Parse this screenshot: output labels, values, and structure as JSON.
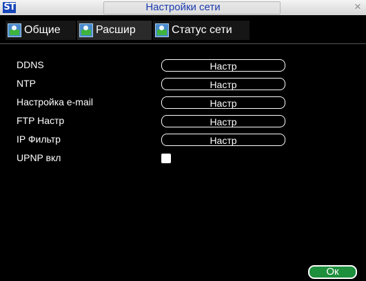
{
  "window": {
    "title": "Настройки сети",
    "logo_text": "ST",
    "close_symbol": "×"
  },
  "tabs": [
    {
      "label": "Общие",
      "active": false,
      "icon": "network-settings-icon"
    },
    {
      "label": "Расшир",
      "active": true,
      "icon": "network-settings-icon"
    },
    {
      "label": "Статус сети",
      "active": false,
      "icon": "network-settings-icon"
    }
  ],
  "settings": [
    {
      "label": "DDNS",
      "button": "Настр"
    },
    {
      "label": "NTP",
      "button": "Настр"
    },
    {
      "label": "Настройка e-mail",
      "button": "Настр"
    },
    {
      "label": "FTP Настр",
      "button": "Настр"
    },
    {
      "label": "IP Фильтр",
      "button": "Настр"
    }
  ],
  "upnp": {
    "label": "UPNP вкл",
    "checked": false
  },
  "ok_button": "Ок",
  "colors": {
    "title_text": "#1a3ab0",
    "logo_bg": "#1746b8",
    "ok_bg": "#1e8f3d",
    "background": "#000000"
  }
}
